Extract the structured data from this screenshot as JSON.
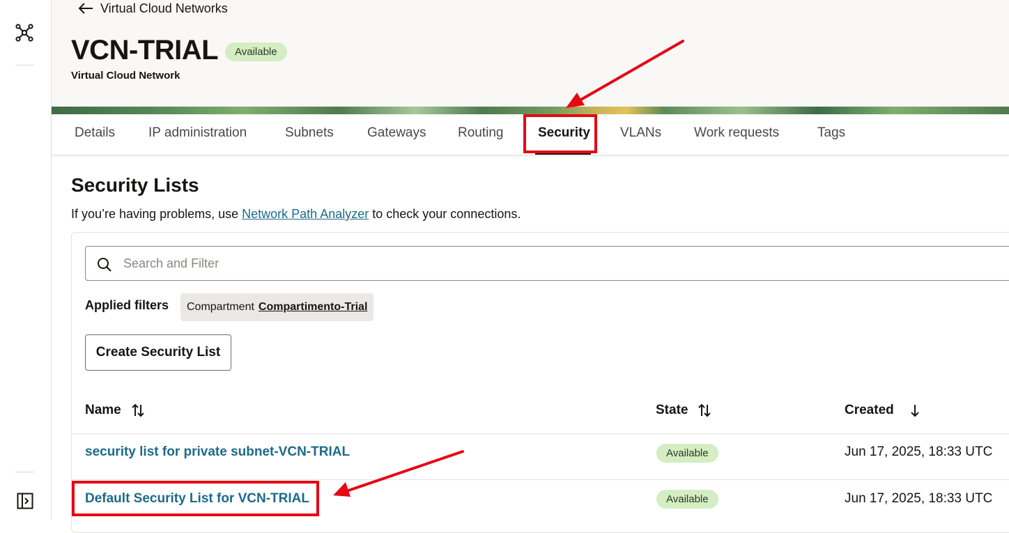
{
  "breadcrumb": {
    "back_label": "Virtual Cloud Networks"
  },
  "resource": {
    "name": "VCN-TRIAL",
    "status": "Available",
    "type": "Virtual Cloud Network"
  },
  "tabs": [
    "Details",
    "IP administration",
    "Subnets",
    "Gateways",
    "Routing",
    "Security",
    "VLANs",
    "Work requests",
    "Tags"
  ],
  "active_tab": "Security",
  "section": {
    "title": "Security Lists",
    "helper_prefix": "If you’re having problems, use ",
    "helper_link": "Network Path Analyzer",
    "helper_suffix": " to check your connections."
  },
  "search": {
    "placeholder": "Search and Filter"
  },
  "filters": {
    "label": "Applied filters",
    "chip_key": "Compartment",
    "chip_value": "Compartimento-Trial"
  },
  "create_button": "Create Security List",
  "table": {
    "columns": {
      "name": "Name",
      "state": "State",
      "created": "Created"
    },
    "rows": [
      {
        "name": "security list for private subnet-VCN-TRIAL",
        "state": "Available",
        "created": "Jun 17, 2025, 18:33 UTC"
      },
      {
        "name": "Default Security List for VCN-TRIAL",
        "state": "Available",
        "created": "Jun 17, 2025, 18:33 UTC"
      }
    ]
  },
  "colors": {
    "accent_link": "#1d6a8a",
    "status_green_bg": "#d4edc3",
    "annotation_red": "#e50914"
  },
  "icons": [
    "network-icon",
    "back-arrow-icon",
    "search-icon",
    "sort-icon",
    "sort-down-icon",
    "expand-panel-icon"
  ]
}
